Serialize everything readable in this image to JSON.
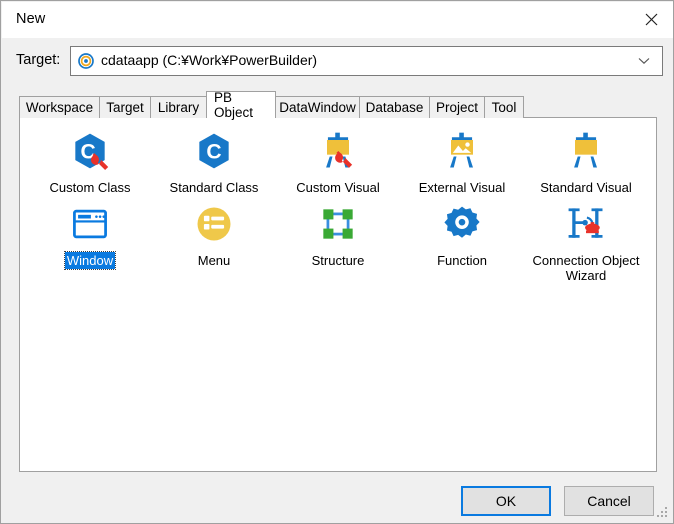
{
  "window": {
    "title": "New",
    "close_icon": "close-icon"
  },
  "target": {
    "label": "Target:",
    "icon": "target-bullseye-icon",
    "value": "cdataapp (C:¥Work¥PowerBuilder)",
    "arrow_icon": "chevron-down-icon"
  },
  "tabs": [
    {
      "label": "Workspace",
      "active": false
    },
    {
      "label": "Target",
      "active": false
    },
    {
      "label": "Library",
      "active": false
    },
    {
      "label": "PB Object",
      "active": true
    },
    {
      "label": "DataWindow",
      "active": false
    },
    {
      "label": "Database",
      "active": false
    },
    {
      "label": "Project",
      "active": false
    },
    {
      "label": "Tool",
      "active": false
    }
  ],
  "objects": [
    {
      "label": "Custom Class",
      "icon": "custom-class-icon",
      "selected": false
    },
    {
      "label": "Standard Class",
      "icon": "standard-class-icon",
      "selected": false
    },
    {
      "label": "Custom Visual",
      "icon": "custom-visual-icon",
      "selected": false
    },
    {
      "label": "External Visual",
      "icon": "external-visual-icon",
      "selected": false
    },
    {
      "label": "Standard Visual",
      "icon": "standard-visual-icon",
      "selected": false
    },
    {
      "label": "Window",
      "icon": "window-icon",
      "selected": true
    },
    {
      "label": "Menu",
      "icon": "menu-icon",
      "selected": false
    },
    {
      "label": "Structure",
      "icon": "structure-icon",
      "selected": false
    },
    {
      "label": "Function",
      "icon": "function-gear-icon",
      "selected": false
    },
    {
      "label": "Connection Object Wizard",
      "icon": "connection-object-wizard-icon",
      "selected": false
    }
  ],
  "footer": {
    "ok_label": "OK",
    "cancel_label": "Cancel"
  },
  "colors": {
    "accent_blue": "#1878c8",
    "selection_blue": "#0a7ae0",
    "icon_gold": "#efc03a",
    "icon_red": "#e8322a",
    "icon_green": "#3aa935",
    "dialog_bg": "#f0f0f0"
  }
}
